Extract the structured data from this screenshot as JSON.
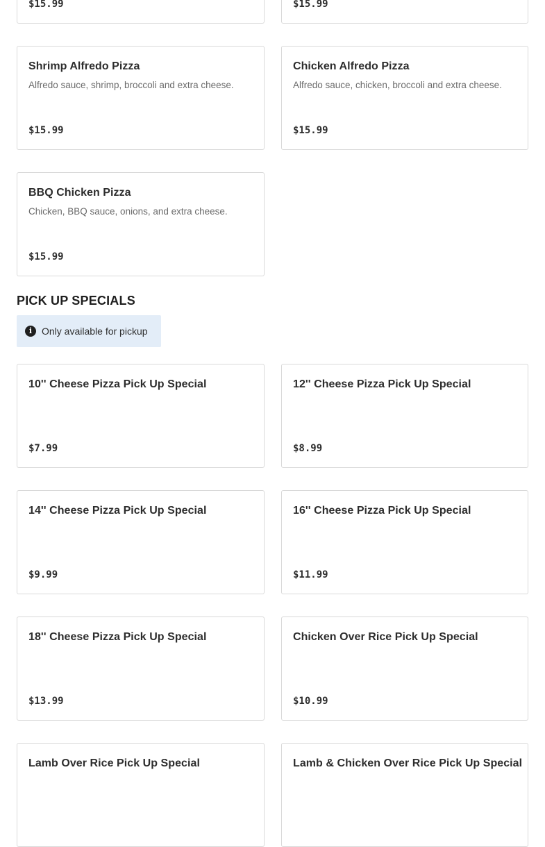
{
  "pizza_section": {
    "items": [
      {
        "name": "",
        "description": "",
        "price": "$15.99"
      },
      {
        "name": "",
        "description": "",
        "price": "$15.99"
      },
      {
        "name": "Shrimp Alfredo Pizza",
        "description": "Alfredo sauce, shrimp, broccoli and extra cheese.",
        "price": "$15.99"
      },
      {
        "name": "Chicken Alfredo Pizza",
        "description": "Alfredo sauce, chicken, broccoli and extra cheese.",
        "price": "$15.99"
      },
      {
        "name": "BBQ Chicken Pizza",
        "description": "Chicken, BBQ sauce, onions, and extra cheese.",
        "price": "$15.99"
      }
    ]
  },
  "pickup_section": {
    "title": "PICK UP SPECIALS",
    "notice_icon": "info-icon",
    "notice_text": "Only available for pickup",
    "items": [
      {
        "name": "10'' Cheese Pizza Pick Up Special",
        "price": "$7.99"
      },
      {
        "name": "12'' Cheese Pizza Pick Up Special",
        "price": "$8.99"
      },
      {
        "name": "14'' Cheese Pizza Pick Up Special",
        "price": "$9.99"
      },
      {
        "name": "16'' Cheese Pizza Pick Up Special",
        "price": "$11.99"
      },
      {
        "name": "18'' Cheese Pizza Pick Up Special",
        "price": "$13.99"
      },
      {
        "name": "Chicken Over Rice Pick Up Special",
        "price": "$10.99"
      },
      {
        "name": "Lamb Over Rice Pick Up Special",
        "price": ""
      },
      {
        "name": "Lamb & Chicken Over Rice Pick Up Special",
        "price": ""
      }
    ]
  },
  "colors": {
    "card_border": "#d9d9d9",
    "notice_background": "#e3edf8",
    "text_primary": "#2d2d2d",
    "text_secondary": "#6b6b6b"
  }
}
